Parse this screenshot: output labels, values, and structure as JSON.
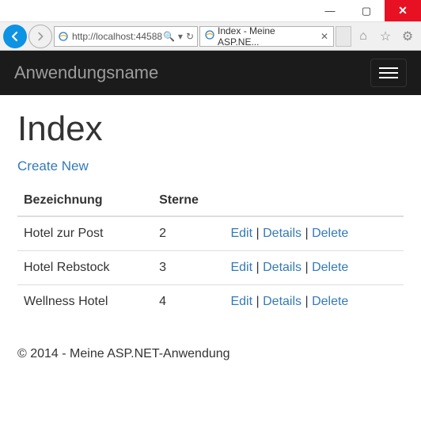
{
  "window": {
    "minimize": "—",
    "maximize": "▢",
    "close": "✕"
  },
  "browser": {
    "url": "http://localhost:44588",
    "url_suffix": "",
    "search_hint": "",
    "tab_title": "Index - Meine ASP.NE...",
    "magnifier": "➔"
  },
  "navbar": {
    "brand": "Anwendungsname"
  },
  "page": {
    "title": "Index",
    "create_label": "Create New",
    "columns": {
      "name": "Bezeichnung",
      "stars": "Sterne",
      "actions": ""
    },
    "actions": {
      "edit": "Edit",
      "details": "Details",
      "delete": "Delete",
      "sep": " | "
    },
    "rows": [
      {
        "name": "Hotel zur Post",
        "stars": "2"
      },
      {
        "name": "Hotel Rebstock",
        "stars": "3"
      },
      {
        "name": "Wellness Hotel",
        "stars": "4"
      }
    ],
    "footer": "© 2014 - Meine ASP.NET-Anwendung"
  }
}
